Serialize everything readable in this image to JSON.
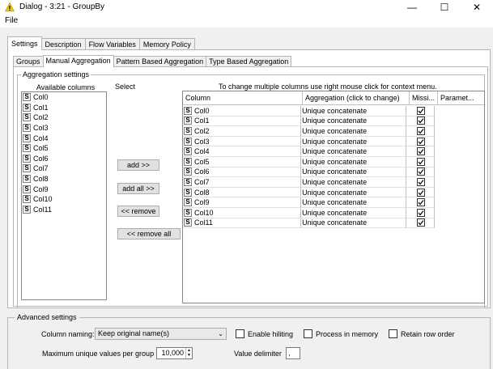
{
  "window": {
    "title": "Dialog - 3:21 - GroupBy"
  },
  "menu": {
    "file": "File"
  },
  "top_tabs": [
    "Settings",
    "Description",
    "Flow Variables",
    "Memory Policy"
  ],
  "inner_tabs": [
    "Groups",
    "Manual Aggregation",
    "Pattern Based Aggregation",
    "Type Based Aggregation"
  ],
  "aggregation": {
    "legend": "Aggregation settings",
    "available_title": "Available columns",
    "available_columns": [
      "Col0",
      "Col1",
      "Col2",
      "Col3",
      "Col4",
      "Col5",
      "Col6",
      "Col7",
      "Col8",
      "Col9",
      "Col10",
      "Col11"
    ],
    "select_label": "Select",
    "buttons": {
      "add": "add >>",
      "add_all": "add all >>",
      "remove": "<< remove",
      "remove_all": "<< remove all"
    },
    "hint": "To change multiple columns use right mouse click for context menu.",
    "table": {
      "headers": [
        "Column",
        "Aggregation (click to change)",
        "Missi...",
        "Paramet..."
      ],
      "rows": [
        {
          "column": "Col0",
          "aggregation": "Unique concatenate",
          "missing": true
        },
        {
          "column": "Col1",
          "aggregation": "Unique concatenate",
          "missing": true
        },
        {
          "column": "Col2",
          "aggregation": "Unique concatenate",
          "missing": true
        },
        {
          "column": "Col3",
          "aggregation": "Unique concatenate",
          "missing": true
        },
        {
          "column": "Col4",
          "aggregation": "Unique concatenate",
          "missing": true
        },
        {
          "column": "Col5",
          "aggregation": "Unique concatenate",
          "missing": true
        },
        {
          "column": "Col6",
          "aggregation": "Unique concatenate",
          "missing": true
        },
        {
          "column": "Col7",
          "aggregation": "Unique concatenate",
          "missing": true
        },
        {
          "column": "Col8",
          "aggregation": "Unique concatenate",
          "missing": true
        },
        {
          "column": "Col9",
          "aggregation": "Unique concatenate",
          "missing": true
        },
        {
          "column": "Col10",
          "aggregation": "Unique concatenate",
          "missing": true
        },
        {
          "column": "Col11",
          "aggregation": "Unique concatenate",
          "missing": true
        }
      ]
    }
  },
  "advanced": {
    "legend": "Advanced settings",
    "column_naming_label": "Column naming:",
    "column_naming_value": "Keep original name(s)",
    "enable_hiliting": "Enable hiliting",
    "process_in_memory": "Process in memory",
    "retain_row_order": "Retain row order",
    "max_unique_label": "Maximum unique values per group",
    "max_unique_value": "10,000",
    "value_delimiter_label": "Value delimiter",
    "value_delimiter_value": ","
  },
  "type_badge": "S",
  "colors": {
    "warning_icon": "#f5c518"
  }
}
